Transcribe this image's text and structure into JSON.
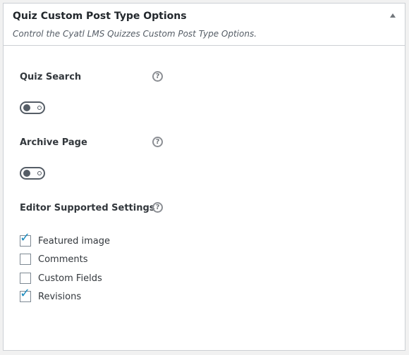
{
  "header": {
    "title": "Quiz Custom Post Type Options",
    "subtitle": "Control the Cyatl LMS Quizzes Custom Post Type Options."
  },
  "fields": {
    "quiz_search": {
      "label": "Quiz Search",
      "help": "?",
      "enabled": false
    },
    "archive_page": {
      "label": "Archive Page",
      "help": "?",
      "enabled": false
    },
    "editor_supported": {
      "label": "Editor Supported Settings",
      "help": "?",
      "options": [
        {
          "label": "Featured image",
          "checked": true
        },
        {
          "label": "Comments",
          "checked": false
        },
        {
          "label": "Custom Fields",
          "checked": false
        },
        {
          "label": "Revisions",
          "checked": true
        }
      ]
    }
  },
  "icons": {
    "check": "✓",
    "collapse": "triangle-up-icon"
  },
  "colors": {
    "check": "#1e8cbe",
    "toggle_off": "#555d66"
  }
}
